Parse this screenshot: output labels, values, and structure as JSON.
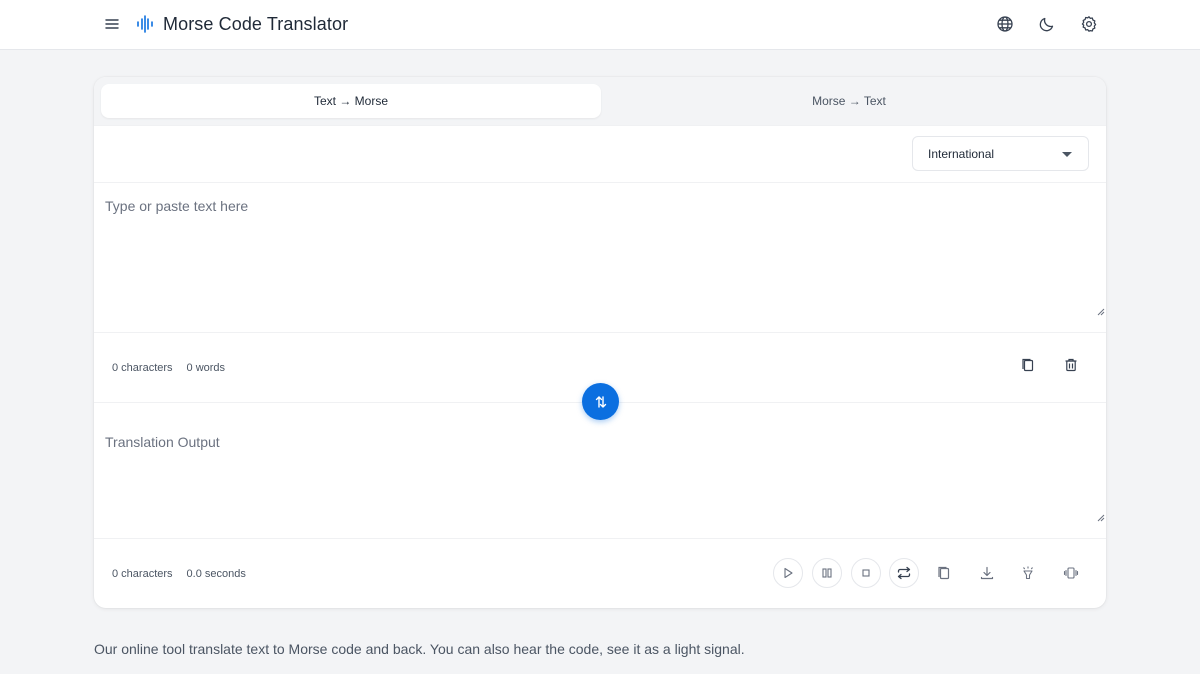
{
  "header": {
    "title": "Morse Code Translator",
    "icons": [
      "menu-icon",
      "audio-wave-icon",
      "globe-icon",
      "moon-icon",
      "gear-icon"
    ]
  },
  "tabs": [
    {
      "label": "Text → Morse",
      "active": true
    },
    {
      "label": "Morse → Text",
      "active": false
    }
  ],
  "settings": {
    "alphabet_selected": "International"
  },
  "input": {
    "placeholder": "Type or paste text here",
    "value": "",
    "characters": "0 characters",
    "words": "0 words"
  },
  "output": {
    "placeholder": "Translation Output",
    "value": "",
    "characters": "0 characters",
    "duration": "0.0 seconds"
  },
  "footer": {
    "text": "Our online tool translate text to Morse code and back. You can also hear the code, see it as a light signal."
  },
  "colors": {
    "accent": "#0b6fe0",
    "background": "#f3f4f6",
    "card": "#ffffff",
    "text": "#1f2937"
  }
}
